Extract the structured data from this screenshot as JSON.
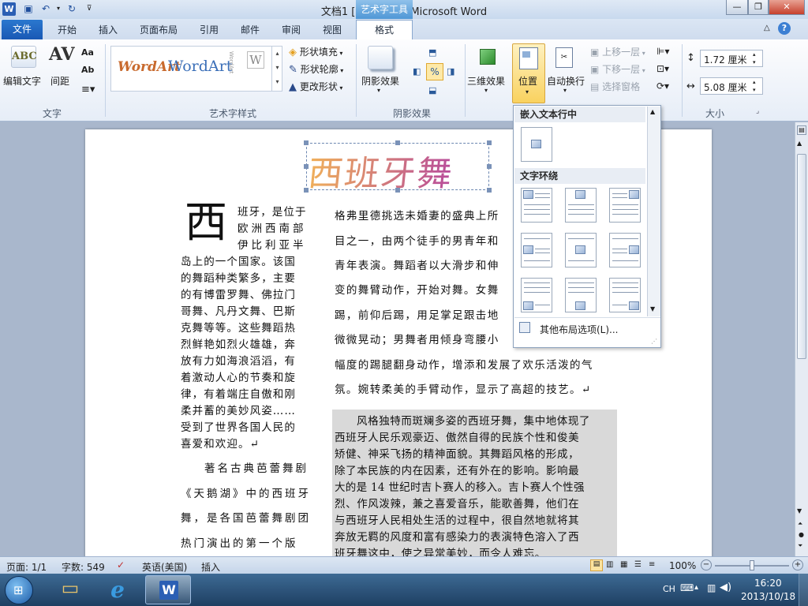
{
  "window": {
    "title": "文档1 [兼容模式] - Microsoft Word",
    "context_group": "艺术字工具"
  },
  "tabs": [
    "文件",
    "开始",
    "插入",
    "页面布局",
    "引用",
    "邮件",
    "审阅",
    "视图",
    "格式"
  ],
  "ribbon": {
    "text_group": {
      "edit_text": "编辑文字",
      "spacing": "间距",
      "label": "文字"
    },
    "wordart_group": {
      "styles": [
        "WordArt",
        "WordArt"
      ],
      "shape_fill": "形状填充",
      "shape_outline": "形状轮廓",
      "change_shape": "更改形状",
      "label": "艺术字样式"
    },
    "shadow_group": {
      "shadow_effects": "阴影效果",
      "label": "阴影效果"
    },
    "threed_group": {
      "threed_effects": "三维效果"
    },
    "arrange_group": {
      "position": "位置",
      "wrap_text": "自动换行",
      "bring_forward": "上移一层",
      "send_backward": "下移一层",
      "selection_pane": "选择窗格"
    },
    "size_group": {
      "height": "1.72 厘米",
      "width": "5.08 厘米",
      "label": "大小"
    }
  },
  "dropdown": {
    "inline_header": "嵌入文本行中",
    "wrap_header": "文字环绕",
    "more_options": "其他布局选项(L)..."
  },
  "document": {
    "wordart": "西班牙舞",
    "dropcap": "西",
    "left_lines": [
      "班牙，是位于",
      "欧洲西南部",
      "伊比利亚半",
      "岛上的一个国家。该国",
      "的舞蹈种类繁多，主要",
      "的有博雷罗舞、佛拉门",
      "哥舞、凡丹文舞、巴斯",
      "克舞等等。这些舞蹈热",
      "烈鲜艳如烈火雄雄，奔",
      "放有力如海浪滔滔，有",
      "着激动人心的节奏和旋",
      "律，有着端庄自傲和刚",
      "柔并蓄的美妙风姿……",
      "受到了世界各国人民的",
      "喜爱和欢迎。↵"
    ],
    "left_para2_lines": [
      "著名古典芭蕾舞剧",
      "《天鹅湖》中的西班牙",
      "舞，是各国芭蕾舞剧团",
      "热门演出的第一个版"
    ],
    "right_lines": [
      "格弗里德挑选未婚妻的盛典上所",
      "目之一，由两个徒手的男青年和",
      "青年表演。舞蹈者以大滑步和伸",
      "变的舞臂动作，开始对舞。女舞",
      "踢，前仰后踢，用足掌足跟击地",
      "微微晃动；男舞者用倾身弯腰小",
      "幅度的踢腿翻身动作，增添和发展了欢乐活泼的气",
      "氛。婉转柔美的手臂动作，显示了高超的技艺。↵"
    ],
    "right_para2_lines": [
      "风格独特而斑斓多姿的西班牙舞，集中地体现了",
      "西班牙人民乐观豪迈、傲然自得的民族个性和俊美",
      "矫健、神采飞扬的精神面貌。其舞蹈风格的形成，",
      "除了本民族的内在因素，还有外在的影响。影响最",
      "大的是 14 世纪时吉卜赛人的移入。吉卜赛人个性强",
      "烈、作风泼辣，兼之喜爱音乐，能歌善舞，他们在",
      "与西班牙人民相处生活的过程中，很自然地就将其",
      "奔放无羁的风度和富有感染力的表演特色溶入了西",
      "班牙舞这中，使之异常美妙，而令人难忘。"
    ]
  },
  "status": {
    "page": "页面: 1/1",
    "words": "字数: 549",
    "language": "英语(美国)",
    "mode": "插入",
    "zoom": "100%"
  },
  "taskbar": {
    "ime": "CH",
    "time": "16:20",
    "date": "2013/10/18"
  },
  "colors": {
    "file_tab": "#1958b4",
    "context_tab": "#4f97d6",
    "position_button": "#f9d25f",
    "highlight": "#d9d9d9"
  }
}
